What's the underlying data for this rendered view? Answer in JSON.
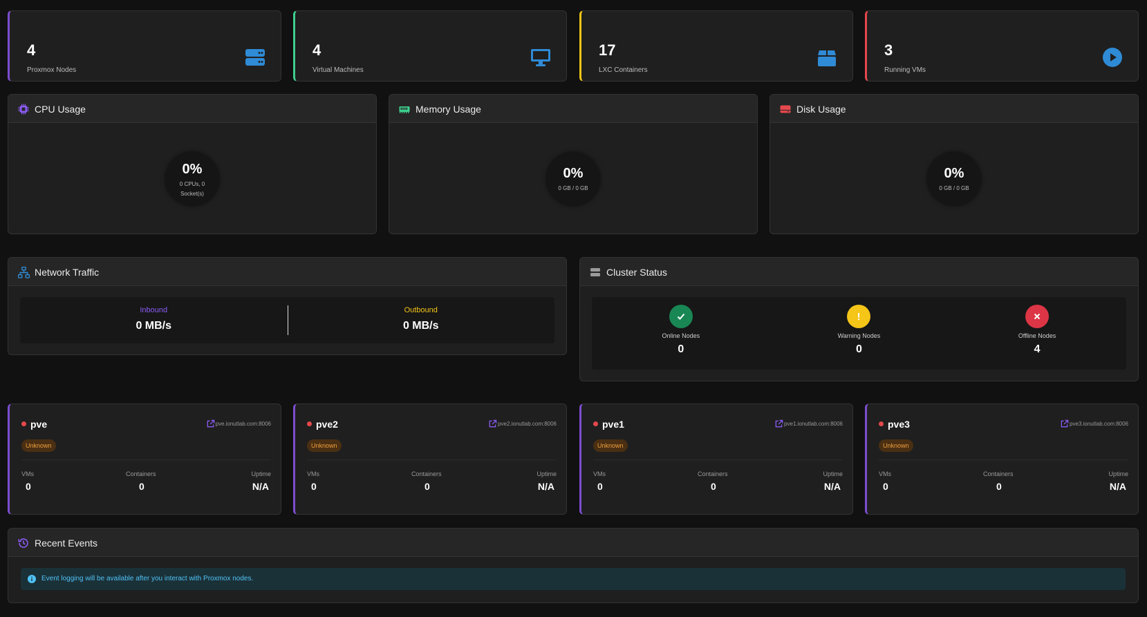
{
  "stats": [
    {
      "value": "4",
      "label": "Proxmox Nodes",
      "icon": "server-icon",
      "accent": "#7c4dcf",
      "icon_color": "#2f8bd6"
    },
    {
      "value": "4",
      "label": "Virtual Machines",
      "icon": "desktop-icon",
      "accent": "#3ecf8e",
      "icon_color": "#2f8bd6"
    },
    {
      "value": "17",
      "label": "LXC Containers",
      "icon": "box-icon",
      "accent": "#f5c518",
      "icon_color": "#2f8bd6"
    },
    {
      "value": "3",
      "label": "Running VMs",
      "icon": "play-circle-icon",
      "accent": "#e5484d",
      "icon_color": "#2f8bd6"
    }
  ],
  "cpu": {
    "title": "CPU Usage",
    "percent": "0%",
    "detail": "0 CPUs, 0 Socket(s)",
    "icon": "cpu-icon",
    "icon_color": "#8b5cf6"
  },
  "memory": {
    "title": "Memory Usage",
    "percent": "0%",
    "detail": "0 GB / 0 GB",
    "icon": "memory-icon",
    "icon_color": "#3ecf8e"
  },
  "disk": {
    "title": "Disk Usage",
    "percent": "0%",
    "detail": "0 GB / 0 GB",
    "icon": "hdd-icon",
    "icon_color": "#e5484d"
  },
  "network": {
    "title": "Network Traffic",
    "icon": "network-icon",
    "inbound_label": "Inbound",
    "inbound_value": "0 MB/s",
    "outbound_label": "Outbound",
    "outbound_value": "0 MB/s",
    "inbound_color": "#8b5cf6",
    "outbound_color": "#f5c518"
  },
  "cluster": {
    "title": "Cluster Status",
    "icon": "server-stack-icon",
    "online_label": "Online Nodes",
    "online_value": "0",
    "warning_label": "Warning Nodes",
    "warning_value": "0",
    "offline_label": "Offline Nodes",
    "offline_value": "4",
    "online_color": "#198754",
    "warning_color": "#f5c518",
    "offline_color": "#dc3545"
  },
  "nodes": [
    {
      "name": "pve",
      "url": "pve.ionutlab.com:8006",
      "status": "Unknown",
      "vms_label": "VMs",
      "vms": "0",
      "containers_label": "Containers",
      "containers": "0",
      "uptime_label": "Uptime",
      "uptime": "N/A"
    },
    {
      "name": "pve2",
      "url": "pve2.ionutlab.com:8006",
      "status": "Unknown",
      "vms_label": "VMs",
      "vms": "0",
      "containers_label": "Containers",
      "containers": "0",
      "uptime_label": "Uptime",
      "uptime": "N/A"
    },
    {
      "name": "pve1",
      "url": "pve1.ionutlab.com:8006",
      "status": "Unknown",
      "vms_label": "VMs",
      "vms": "0",
      "containers_label": "Containers",
      "containers": "0",
      "uptime_label": "Uptime",
      "uptime": "N/A"
    },
    {
      "name": "pve3",
      "url": "pve3.ionutlab.com:8006",
      "status": "Unknown",
      "vms_label": "VMs",
      "vms": "0",
      "containers_label": "Containers",
      "containers": "0",
      "uptime_label": "Uptime",
      "uptime": "N/A"
    }
  ],
  "events": {
    "title": "Recent Events",
    "icon": "history-icon",
    "message": "Event logging will be available after you interact with Proxmox nodes."
  }
}
